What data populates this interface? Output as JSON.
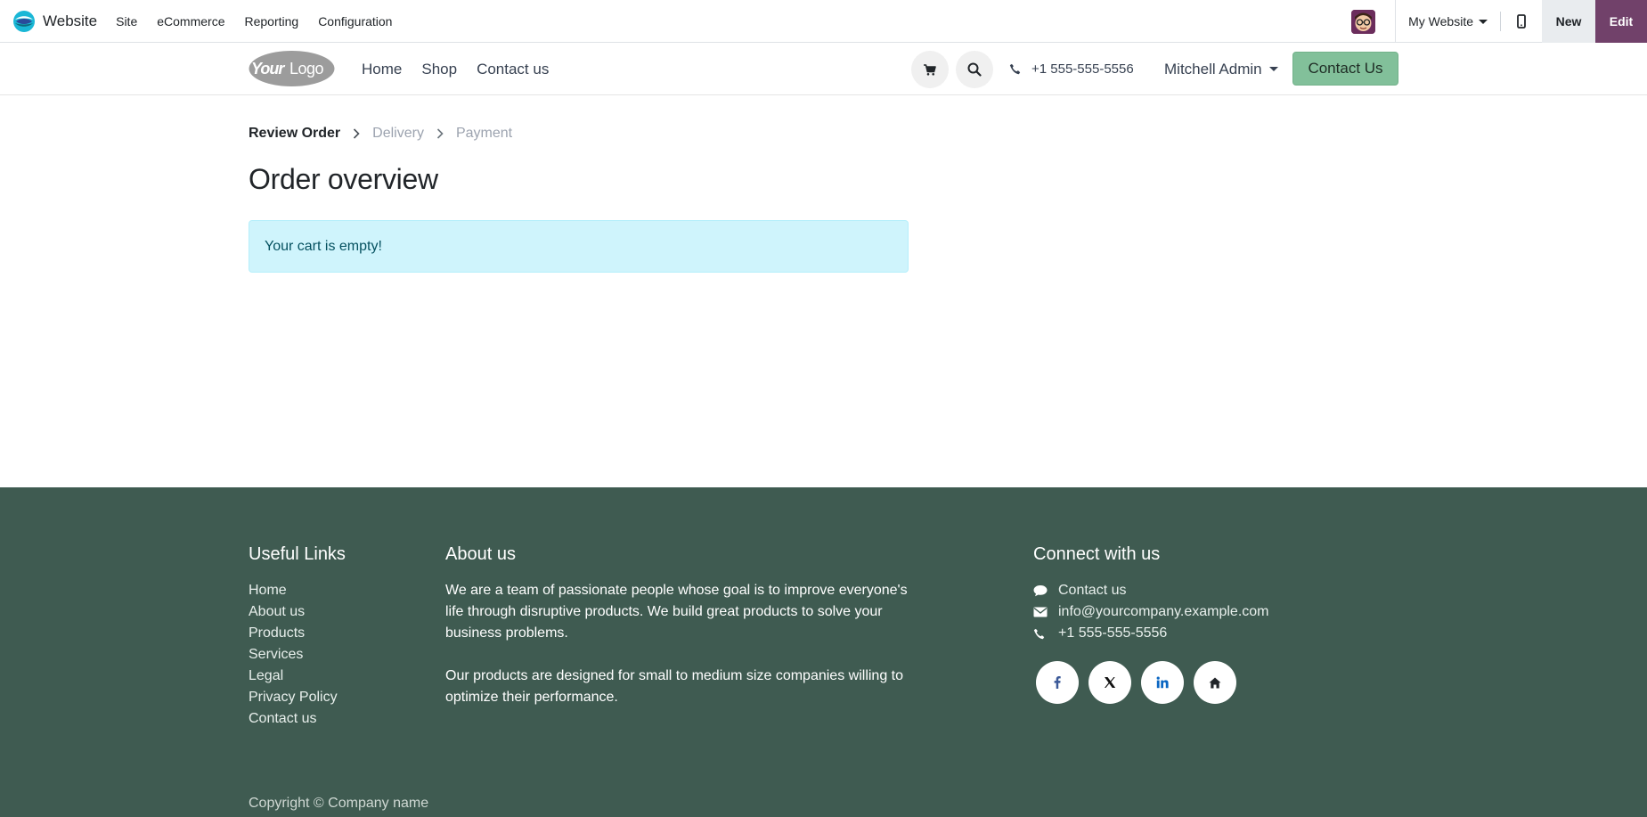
{
  "adminbar": {
    "app_name": "Website",
    "menu": [
      "Site",
      "eCommerce",
      "Reporting",
      "Configuration"
    ],
    "website_switcher": "My Website",
    "new_label": "New",
    "edit_label": "Edit"
  },
  "header": {
    "logo_text": "YourLogo",
    "nav": [
      "Home",
      "Shop",
      "Contact us"
    ],
    "phone": "+1 555-555-5556",
    "user": "Mitchell Admin",
    "cta": "Contact Us"
  },
  "checkout": {
    "steps": [
      {
        "label": "Review Order",
        "active": true
      },
      {
        "label": "Delivery",
        "active": false
      },
      {
        "label": "Payment",
        "active": false
      }
    ],
    "title": "Order overview",
    "empty_message": "Your cart is empty!"
  },
  "footer": {
    "useful_links": {
      "title": "Useful Links",
      "items": [
        "Home",
        "About us",
        "Products",
        "Services",
        "Legal",
        "Privacy Policy",
        "Contact us"
      ]
    },
    "about": {
      "title": "About us",
      "paragraphs": [
        "We are a team of passionate people whose goal is to improve everyone's life through disruptive products. We build great products to solve your business problems.",
        "Our products are designed for small to medium size companies willing to optimize their performance."
      ]
    },
    "connect": {
      "title": "Connect with us",
      "items": [
        {
          "icon": "comment-icon",
          "label": "Contact us"
        },
        {
          "icon": "envelope-icon",
          "label": "info@yourcompany.example.com"
        },
        {
          "icon": "phone-icon",
          "label": "+1 555-555-5556"
        }
      ],
      "socials": [
        "facebook-icon",
        "x-twitter-icon",
        "linkedin-icon",
        "home-icon"
      ]
    },
    "copyright": "Copyright © Company name"
  },
  "colors": {
    "brand_purple": "#71416a",
    "cta_green": "#82c09a",
    "footer_bg": "#3f5b51",
    "alert_bg": "#cff4fc",
    "alert_text": "#055160"
  }
}
